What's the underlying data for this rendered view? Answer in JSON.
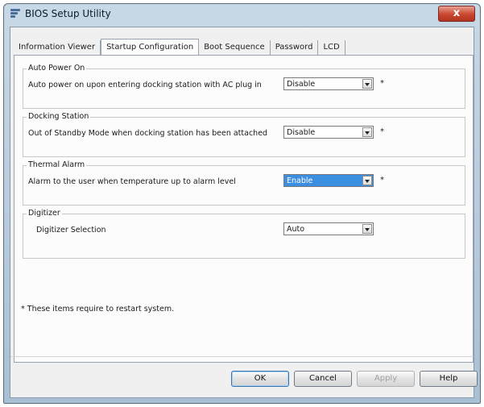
{
  "window": {
    "title": "BIOS Setup Utility",
    "close_label": "x"
  },
  "tabs": [
    {
      "label": "Information Viewer"
    },
    {
      "label": "Startup Configuration"
    },
    {
      "label": "Boot Sequence"
    },
    {
      "label": "Password"
    },
    {
      "label": "LCD"
    }
  ],
  "groups": [
    {
      "legend": "Auto Power On",
      "label": "Auto power on upon entering docking station with AC plug in",
      "value": "Disable",
      "required": "*"
    },
    {
      "legend": "Docking Station",
      "label": "Out of Standby Mode when docking station has been attached",
      "value": "Disable",
      "required": "*"
    },
    {
      "legend": "Thermal Alarm",
      "label": "Alarm to the user when temperature up to alarm level",
      "value": "Enable",
      "required": "*"
    },
    {
      "legend": "Digitizer",
      "label": "Digitizer Selection",
      "value": "Auto",
      "required": ""
    }
  ],
  "note": "* These items require to restart system.",
  "buttons": {
    "ok": "OK",
    "cancel": "Cancel",
    "apply": "Apply",
    "help": "Help"
  },
  "colors": {
    "selection": "#3c8ee0",
    "close_button": "#c9472f"
  },
  "icons": {
    "app": "bios-app-icon",
    "dropdown": "chevron-down-icon",
    "close": "close-icon"
  }
}
